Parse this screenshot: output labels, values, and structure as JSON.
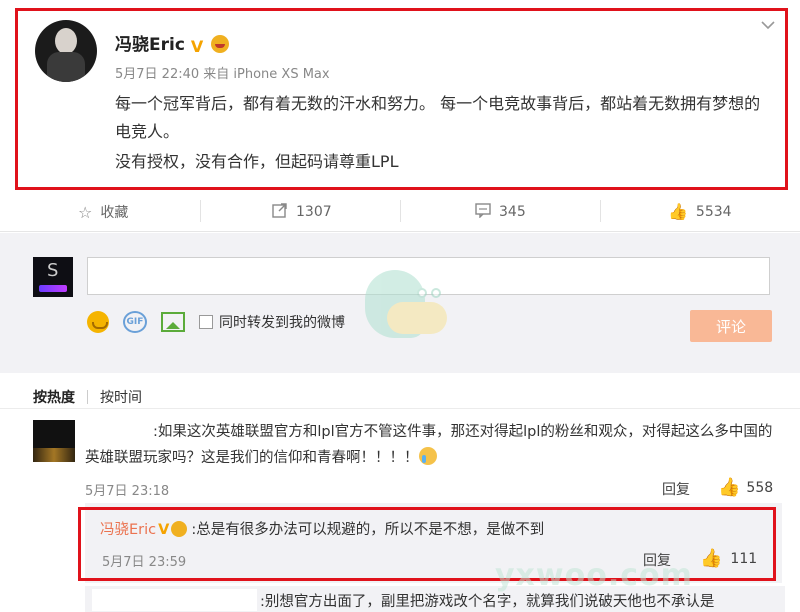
{
  "post": {
    "username": "冯骁Eric",
    "verify_icon": "V",
    "meta": "5月7日 22:40 来自 iPhone XS Max",
    "paragraphs": [
      "每一个冠军背后，都有着无数的汗水和努力。 每一个电竞故事背后，都站着无数拥有梦想的电竞人。",
      "没有授权，没有合作，但起码请尊重LPL"
    ]
  },
  "actions": {
    "favorite": "收藏",
    "forward_count": "1307",
    "comment_count": "345",
    "like_count": "5534"
  },
  "composer": {
    "repost_label": "同时转发到我的微博",
    "submit_label": "评论",
    "gif_label": "GIF"
  },
  "sort": {
    "hot": "按热度",
    "time": "按时间"
  },
  "comments": [
    {
      "text": ":如果这次英雄联盟官方和lpl官方不管这件事，那还对得起lpl的粉丝和观众，对得起这么多中国的英雄联盟玩家吗？这是我们的信仰和青春啊！！！！",
      "time": "5月7日 23:18",
      "reply_label": "回复",
      "likes": "558",
      "reply": {
        "name": "冯骁Eric",
        "text": ":总是有很多办法可以规避的，所以不是不想，是做不到",
        "time": "5月7日 23:59",
        "reply_label": "回复",
        "likes": "111"
      }
    }
  ],
  "partial_comment": {
    "text": ":别想官方出面了，副里把游戏改个名字，就算我们说破天他也不承认是"
  },
  "watermark": "yxwoo.com",
  "icons": [
    "star-icon",
    "forward-icon",
    "comment-icon",
    "thumb-up-icon",
    "chevron-down-icon",
    "emoji-icon",
    "gif-icon",
    "image-icon"
  ],
  "colors": {
    "highlight_border": "#e0121b",
    "link_orange": "#eb7350",
    "submit_bg": "#f9b896",
    "verify_gold": "#f5a300"
  }
}
